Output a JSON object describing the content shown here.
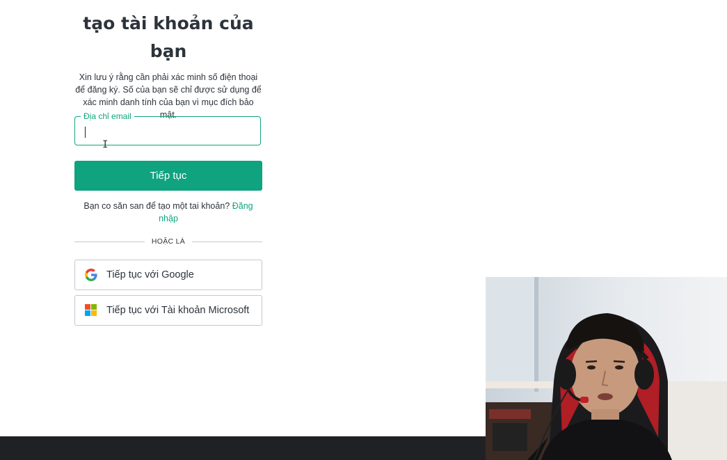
{
  "signup": {
    "title": "tạo tài khoản của bạn",
    "description": "Xin lưu ý rằng cần phải xác minh số điện thoại để đăng ký. Số của bạn sẽ chỉ được sử dụng để xác minh danh tính của bạn vì mục đích bảo mật.",
    "email_field": {
      "label": "Địa chỉ email",
      "value": ""
    },
    "continue_label": "Tiếp tục",
    "login_prompt": "Bạn co săn san để tạo một tai khoản?",
    "login_link": "Đăng nhập",
    "divider_text": "HOẶC LÀ",
    "google_label": "Tiếp tục với Google",
    "microsoft_label": "Tiếp tục với Tài khoản Microsoft"
  },
  "colors": {
    "accent": "#10a37f",
    "text": "#2d333a",
    "border": "#c2c8d0",
    "bottom_bar": "#202124"
  },
  "icons": [
    "google-icon",
    "microsoft-icon",
    "text-cursor-icon"
  ]
}
